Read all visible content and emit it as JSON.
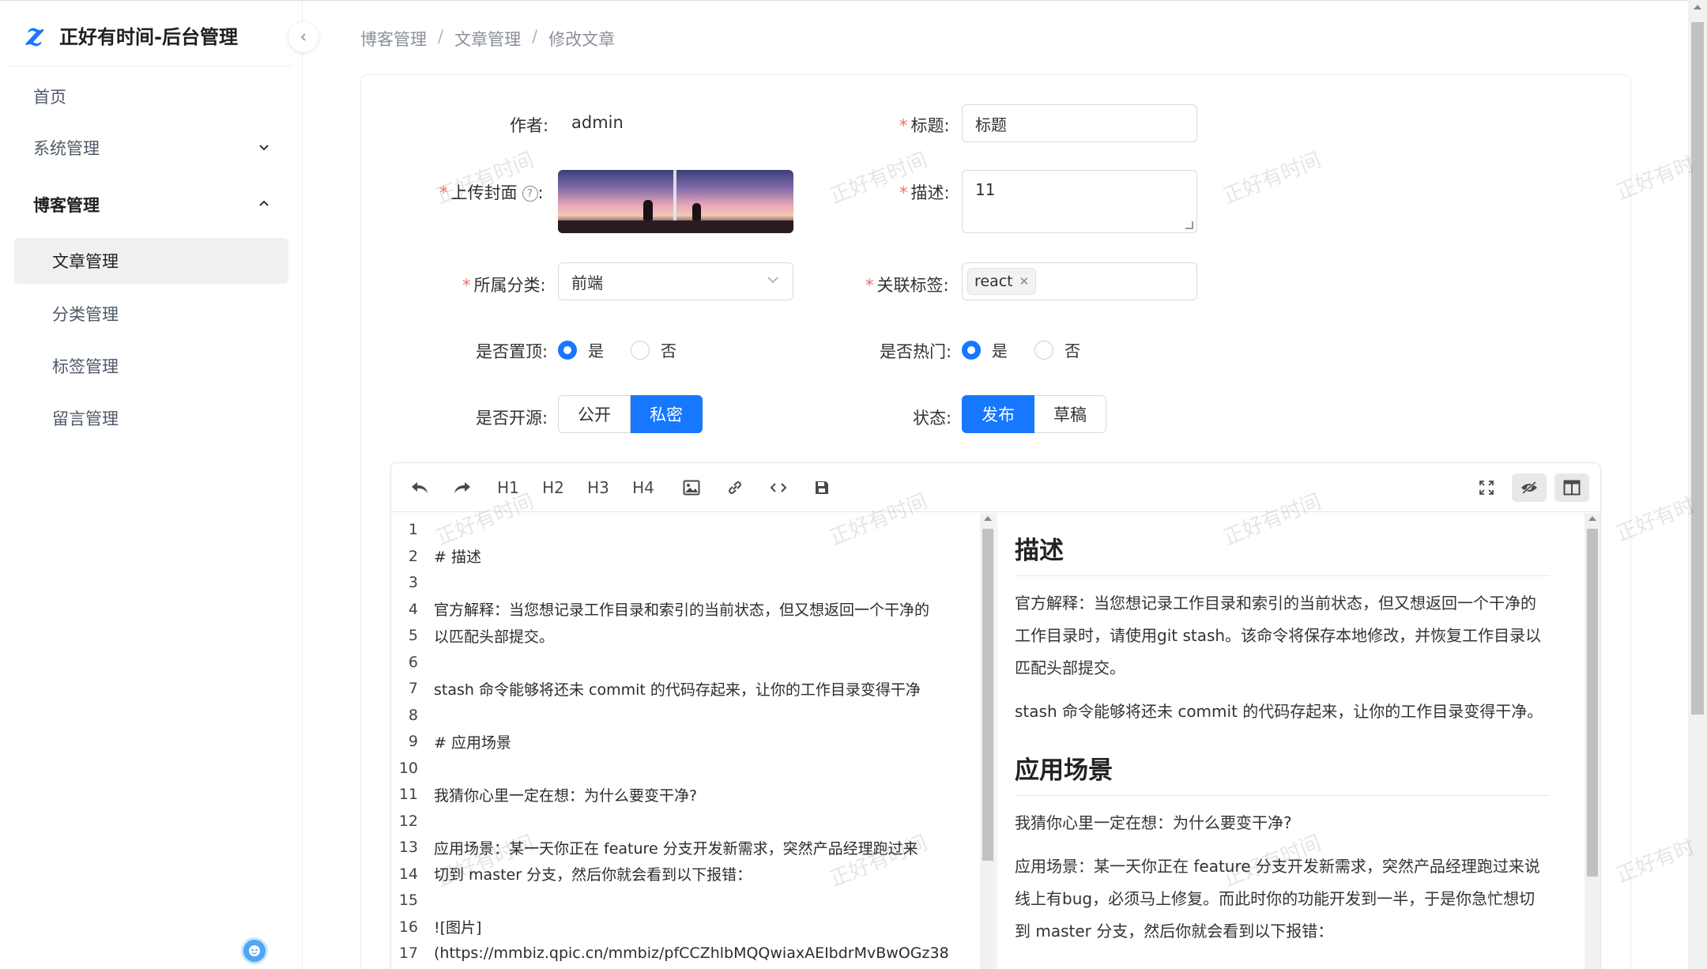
{
  "app": {
    "title": "正好有时间-后台管理",
    "logo_glyph": "z"
  },
  "sidebar": {
    "items": [
      {
        "label": "首页"
      },
      {
        "label": "系统管理"
      },
      {
        "label": "博客管理"
      },
      {
        "label": "文章管理"
      },
      {
        "label": "分类管理"
      },
      {
        "label": "标签管理"
      },
      {
        "label": "留言管理"
      }
    ]
  },
  "breadcrumb": {
    "items": [
      "博客管理",
      "文章管理",
      "修改文章"
    ],
    "separator": "/"
  },
  "form": {
    "author_label": "作者:",
    "author_value": "admin",
    "title_label": "标题:",
    "title_value": "标题",
    "cover_label": "上传封面",
    "cover_colon": ":",
    "desc_label": "描述:",
    "desc_value": "11",
    "category_label": "所属分类:",
    "category_value": "前端",
    "tags_label": "关联标签:",
    "tag_value": "react",
    "pinned_label": "是否置顶:",
    "hot_label": "是否热门:",
    "yes": "是",
    "no": "否",
    "opensource_label": "是否开源:",
    "public_label": "公开",
    "private_label": "私密",
    "status_label": "状态:",
    "publish_label": "发布",
    "draft_label": "草稿"
  },
  "toolbar": {
    "h1": "H1",
    "h2": "H2",
    "h3": "H3",
    "h4": "H4"
  },
  "editor": {
    "lines": [
      {
        "n": "1",
        "text": ""
      },
      {
        "n": "2",
        "text": "# 描述"
      },
      {
        "n": "3",
        "text": ""
      },
      {
        "n": "4",
        "text": "官方解释：当您想记录工作目录和索引的当前状态，但又想返回一个干净的"
      },
      {
        "n": "5",
        "text": "以匹配头部提交。"
      },
      {
        "n": "6",
        "text": ""
      },
      {
        "n": "7",
        "text": "stash 命令能够将还未 commit 的代码存起来，让你的工作目录变得干净"
      },
      {
        "n": "8",
        "text": ""
      },
      {
        "n": "9",
        "text": "# 应用场景"
      },
      {
        "n": "10",
        "text": ""
      },
      {
        "n": "11",
        "text": "我猜你心里一定在想：为什么要变干净?"
      },
      {
        "n": "12",
        "text": ""
      },
      {
        "n": "13",
        "text": "应用场景：某一天你正在 feature 分支开发新需求，突然产品经理跑过来"
      },
      {
        "n": "14",
        "text": "切到 master 分支，然后你就会看到以下报错："
      },
      {
        "n": "15",
        "text": ""
      },
      {
        "n": "16",
        "text": "![图片]"
      },
      {
        "n": "17",
        "text": "(https://mmbiz.qpic.cn/mmbiz/pfCCZhlbMQQwiaxAEIbdrMvBwOGz38"
      }
    ]
  },
  "preview": {
    "h1_a": "描述",
    "p1": "官方解释：当您想记录工作目录和索引的当前状态，但又想返回一个干净的工作目录时，请使用git stash。该命令将保存本地修改，并恢复工作目录以匹配头部提交。",
    "p2": "stash 命令能够将还未 commit 的代码存起来，让你的工作目录变得干净。",
    "h1_b": "应用场景",
    "p3": "我猜你心里一定在想：为什么要变干净?",
    "p4": "应用场景：某一天你正在 feature 分支开发新需求，突然产品经理跑过来说线上有bug，必须马上修复。而此时你的功能开发到一半，于是你急忙想切到 master 分支，然后你就会看到以下报错："
  },
  "watermark": {
    "text": "正好有时间",
    "text_clipped": "正好有时"
  },
  "colors": {
    "primary": "#1677ff",
    "required": "#f56c6c"
  }
}
